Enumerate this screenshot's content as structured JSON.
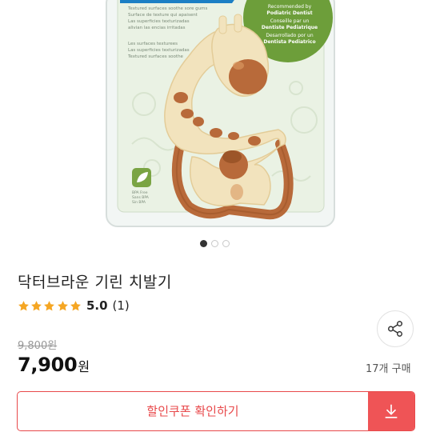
{
  "product": {
    "title": "닥터브라운 기린 치발기",
    "rating_value": "5.0",
    "review_count": "(1)",
    "rating_stars": 5,
    "original_price_value": "9,800",
    "original_price_unit": "원",
    "sale_price_value": "7,900",
    "sale_price_unit": "원",
    "purchase_count": "17개 구매"
  },
  "package_text": {
    "left_block": [
      "Textured surfaces soothe sore gums",
      "Surface de texture qui apaisent",
      "Las superficies texturizadas",
      "alivian las encias irritadas"
    ],
    "left_block_2": [
      "Les surfaces texturees",
      "Las superficies texturizadas",
      "Textured surfaces soothe"
    ],
    "badge_lines": [
      "Recommended by",
      "Podiatric Dentist",
      "Conseille par un",
      "Dentiste Pediatrique",
      "Desarrollado por un",
      "Dentista Pediatrico"
    ],
    "bpa": [
      "BPA Free",
      "Sans BPA",
      "Sin BPA"
    ]
  },
  "carousel": {
    "total": 3,
    "active_index": 0
  },
  "buttons": {
    "coupon_label": "할인쿠폰 확인하기"
  },
  "icons": {
    "star": "star-icon",
    "share": "share-icon",
    "download": "download-icon"
  },
  "colors": {
    "accent": "#e8494b",
    "star": "#f5a623",
    "download_bg": "#ef5456"
  }
}
